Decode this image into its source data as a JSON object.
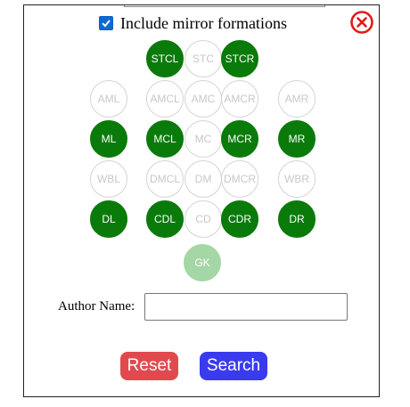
{
  "mirror": {
    "label": "Include mirror formations",
    "checked": true
  },
  "close": {
    "icon": "close-circle-icon",
    "color": "#e01a1a"
  },
  "positions": [
    {
      "code": "STCL",
      "state": "on"
    },
    {
      "code": "STC",
      "state": "off"
    },
    {
      "code": "STCR",
      "state": "on"
    },
    {
      "code": "AML",
      "state": "off"
    },
    {
      "code": "AMCL",
      "state": "off"
    },
    {
      "code": "AMC",
      "state": "off"
    },
    {
      "code": "AMCR",
      "state": "off"
    },
    {
      "code": "AMR",
      "state": "off"
    },
    {
      "code": "ML",
      "state": "on"
    },
    {
      "code": "MCL",
      "state": "on"
    },
    {
      "code": "MC",
      "state": "off"
    },
    {
      "code": "MCR",
      "state": "on"
    },
    {
      "code": "MR",
      "state": "on"
    },
    {
      "code": "WBL",
      "state": "off"
    },
    {
      "code": "DMCL",
      "state": "off"
    },
    {
      "code": "DM",
      "state": "off"
    },
    {
      "code": "DMCR",
      "state": "off"
    },
    {
      "code": "WBR",
      "state": "off"
    },
    {
      "code": "DL",
      "state": "on"
    },
    {
      "code": "CDL",
      "state": "on"
    },
    {
      "code": "CD",
      "state": "off"
    },
    {
      "code": "CDR",
      "state": "on"
    },
    {
      "code": "DR",
      "state": "on"
    },
    {
      "code": "GK",
      "state": "gk"
    }
  ],
  "colors": {
    "selected": "#0a7a0a",
    "unselected_border": "#d4d4d4",
    "goalkeeper": "#a5d6a5"
  },
  "author": {
    "label": "Author Name:",
    "value": "",
    "placeholder": ""
  },
  "buttons": {
    "reset_label": "Reset",
    "search_label": "Search"
  }
}
